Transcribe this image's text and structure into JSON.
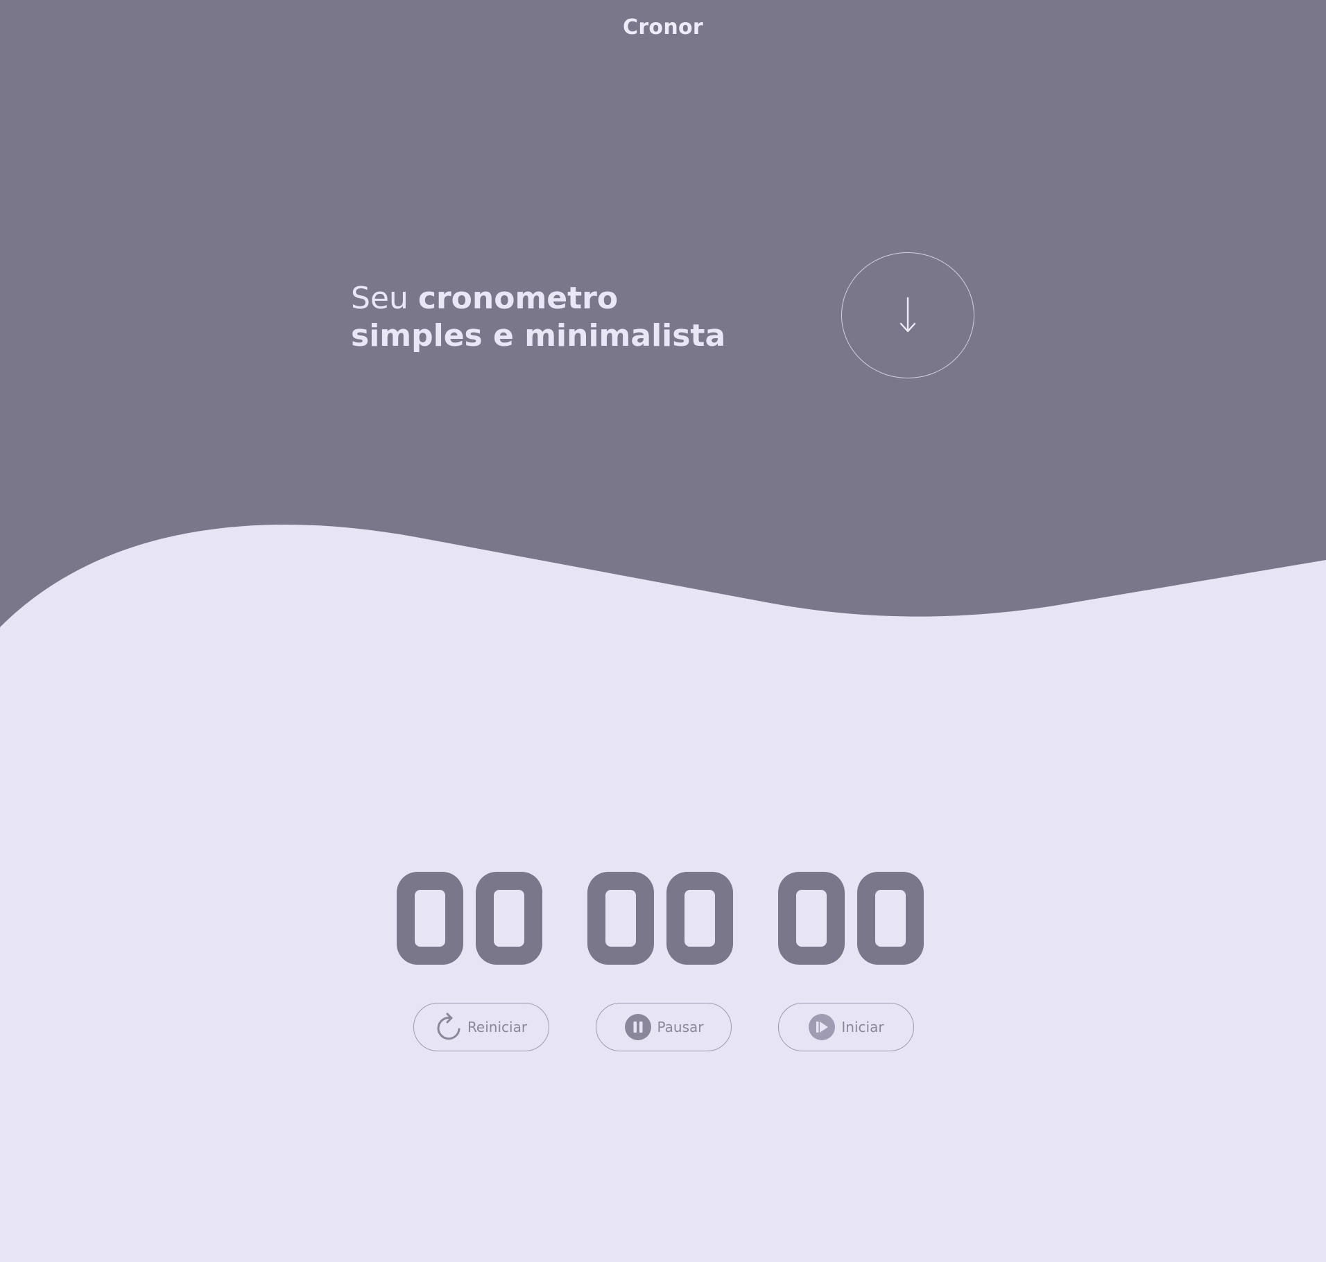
{
  "brand": {
    "name": "Cronor"
  },
  "hero": {
    "headline_prefix": "Seu",
    "headline_bold": "cronometro",
    "headline_line2": "simples e minimalista",
    "scroll_icon": "arrow-down-icon"
  },
  "timer": {
    "hours": "00",
    "minutes": "00",
    "seconds": "00"
  },
  "controls": {
    "restart": {
      "label": "Reiniciar",
      "icon": "restart-icon"
    },
    "pause": {
      "label": "Pausar",
      "icon": "pause-icon"
    },
    "start": {
      "label": "Iniciar",
      "icon": "play-icon"
    }
  },
  "colors": {
    "hero_background": "#7a778b",
    "page_background": "#e7e5f3",
    "hero_text": "#e9e7f6",
    "digits": "#7a778b",
    "button_text": "#8a879b"
  }
}
